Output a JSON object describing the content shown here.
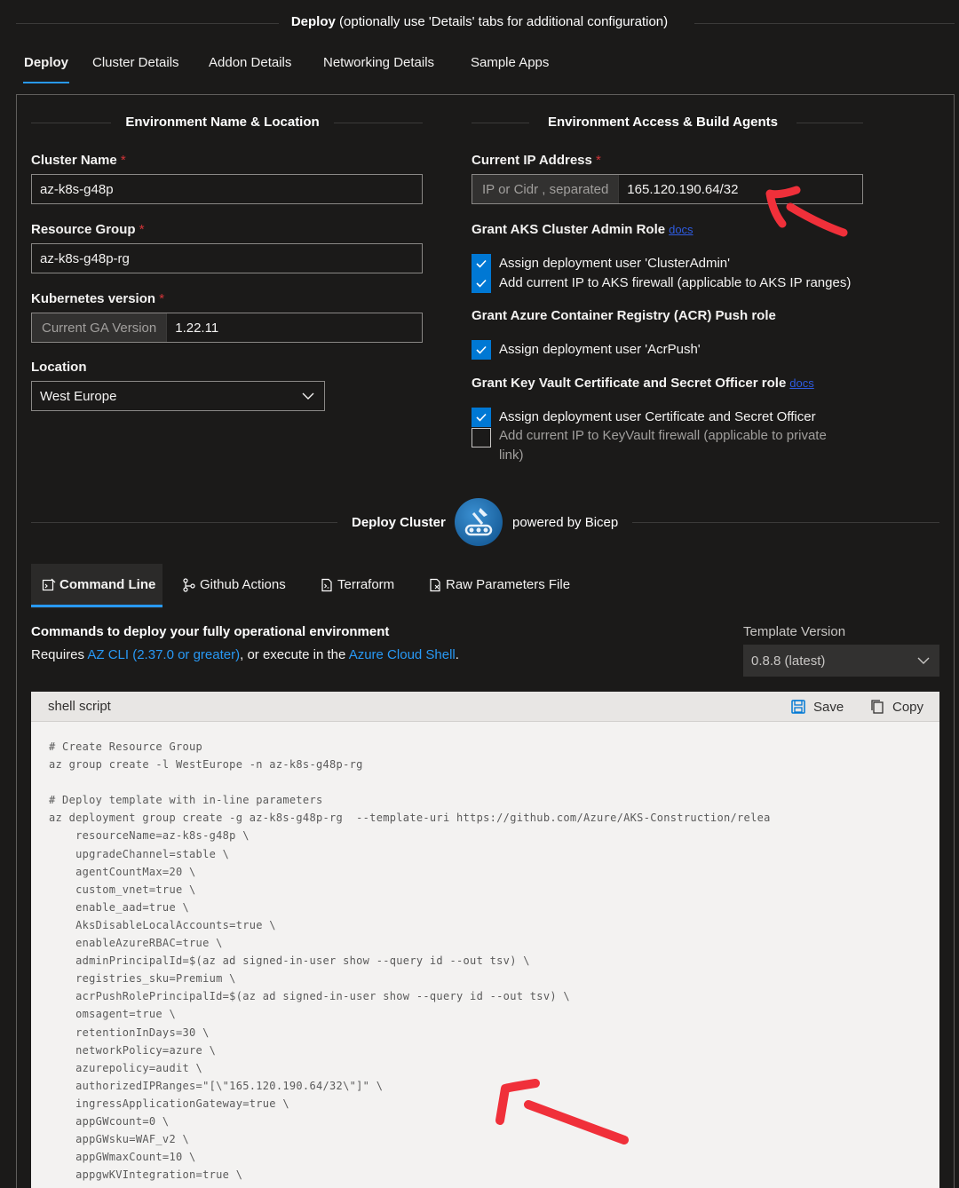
{
  "header": {
    "title_bold": "Deploy",
    "title_rest": " (optionally use 'Details' tabs for additional configuration)"
  },
  "top_tabs": [
    {
      "label": "Deploy",
      "active": true
    },
    {
      "label": "Cluster Details"
    },
    {
      "label": "Addon Details"
    },
    {
      "label": "Networking Details"
    },
    {
      "label": "Sample Apps"
    }
  ],
  "env_section": {
    "title": "Environment Name & Location",
    "cluster_name_label": "Cluster Name",
    "cluster_name_value": "az-k8s-g48p",
    "resource_group_label": "Resource Group",
    "resource_group_value": "az-k8s-g48p-rg",
    "k8s_version_label": "Kubernetes version",
    "k8s_version_prefix": "Current GA Version",
    "k8s_version_value": "1.22.11",
    "location_label": "Location",
    "location_value": "West Europe",
    "required_mark": "*"
  },
  "access_section": {
    "title": "Environment Access & Build Agents",
    "ip_label": "Current IP Address",
    "ip_prefix": "IP or Cidr , separated",
    "ip_value": "165.120.190.64/32",
    "aks_role_label": "Grant AKS Cluster Admin Role",
    "docs_link": "docs",
    "aks_cb1": "Assign deployment user 'ClusterAdmin'",
    "aks_cb2": "Add current IP to AKS firewall (applicable to AKS IP ranges)",
    "acr_label": "Grant Azure Container Registry (ACR) Push role",
    "acr_cb1": "Assign deployment user 'AcrPush'",
    "kv_label": "Grant Key Vault Certificate and Secret Officer role",
    "kv_cb1": "Assign deployment user Certificate and Secret Officer",
    "kv_cb2_line1": "Add current IP to KeyVault firewall (applicable to private",
    "kv_cb2_line2": "link)"
  },
  "deploy_banner": {
    "label": "Deploy Cluster",
    "powered": "powered by Bicep"
  },
  "sub_tabs": [
    {
      "label": "Command Line",
      "icon": "command-line-icon",
      "active": true
    },
    {
      "label": "Github Actions",
      "icon": "github-actions-icon"
    },
    {
      "label": "Terraform",
      "icon": "terraform-icon"
    },
    {
      "label": "Raw Parameters File",
      "icon": "file-icon"
    }
  ],
  "commands": {
    "heading": "Commands to deploy your fully operational environment",
    "requires_prefix": "Requires ",
    "az_cli_link": "AZ CLI (2.37.0 or greater)",
    "middle_text": ", or execute in the ",
    "cloud_shell_link": "Azure Cloud Shell",
    "suffix": "."
  },
  "template_version": {
    "label": "Template Version",
    "value": "0.8.8 (latest)"
  },
  "code_block": {
    "title": "shell script",
    "save_label": "Save",
    "copy_label": "Copy",
    "lines": [
      "# Create Resource Group",
      "az group create -l WestEurope -n az-k8s-g48p-rg",
      "",
      "# Deploy template with in-line parameters",
      "az deployment group create -g az-k8s-g48p-rg  --template-uri https://github.com/Azure/AKS-Construction/relea",
      "    resourceName=az-k8s-g48p \\",
      "    upgradeChannel=stable \\",
      "    agentCountMax=20 \\",
      "    custom_vnet=true \\",
      "    enable_aad=true \\",
      "    AksDisableLocalAccounts=true \\",
      "    enableAzureRBAC=true \\",
      "    adminPrincipalId=$(az ad signed-in-user show --query id --out tsv) \\",
      "    registries_sku=Premium \\",
      "    acrPushRolePrincipalId=$(az ad signed-in-user show --query id --out tsv) \\",
      "    omsagent=true \\",
      "    retentionInDays=30 \\",
      "    networkPolicy=azure \\",
      "    azurepolicy=audit \\",
      "    authorizedIPRanges=\"[\\\"165.120.190.64/32\\\"]\" \\",
      "    ingressApplicationGateway=true \\",
      "    appGWcount=0 \\",
      "    appGWsku=WAF_v2 \\",
      "    appGWmaxCount=10 \\",
      "    appgwKVIntegration=true \\"
    ]
  },
  "colors": {
    "accent": "#2899f5",
    "checkbox": "#0078d4",
    "annotation": "#f0303a"
  }
}
